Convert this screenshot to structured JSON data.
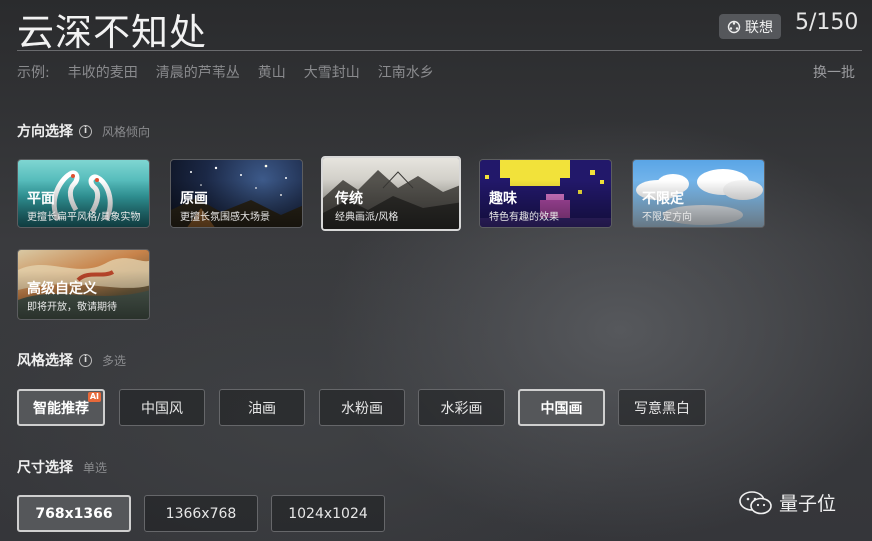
{
  "header": {
    "prompt": "云深不知处",
    "associate_label": "联想",
    "char_count": "5/150"
  },
  "examples": {
    "prefix": "示例:",
    "items": [
      "丰收的麦田",
      "清晨的芦苇丛",
      "黄山",
      "大雪封山",
      "江南水乡"
    ],
    "refresh_label": "换一批"
  },
  "direction": {
    "title": "方向选择",
    "subtitle": "风格倾向",
    "cards": [
      {
        "name": "平面",
        "desc": "更擅长扁平风格/具象实物"
      },
      {
        "name": "原画",
        "desc": "更擅长氛围感大场景"
      },
      {
        "name": "传统",
        "desc": "经典画派/风格",
        "selected": true
      },
      {
        "name": "趣味",
        "desc": "特色有趣的效果"
      },
      {
        "name": "不限定",
        "desc": "不限定方向"
      },
      {
        "name": "高级自定义",
        "desc": "即将开放，敬请期待"
      }
    ]
  },
  "style": {
    "title": "风格选择",
    "subtitle": "多选",
    "chips": [
      {
        "label": "智能推荐",
        "selected": true,
        "badge": "AI"
      },
      {
        "label": "中国风"
      },
      {
        "label": "油画"
      },
      {
        "label": "水粉画"
      },
      {
        "label": "水彩画"
      },
      {
        "label": "中国画",
        "selected": true
      },
      {
        "label": "写意黑白"
      }
    ]
  },
  "size": {
    "title": "尺寸选择",
    "subtitle": "单选",
    "chips": [
      {
        "label": "768x1366",
        "selected": true
      },
      {
        "label": "1366x768"
      },
      {
        "label": "1024x1024"
      }
    ]
  },
  "watermark": {
    "text": "量子位"
  }
}
